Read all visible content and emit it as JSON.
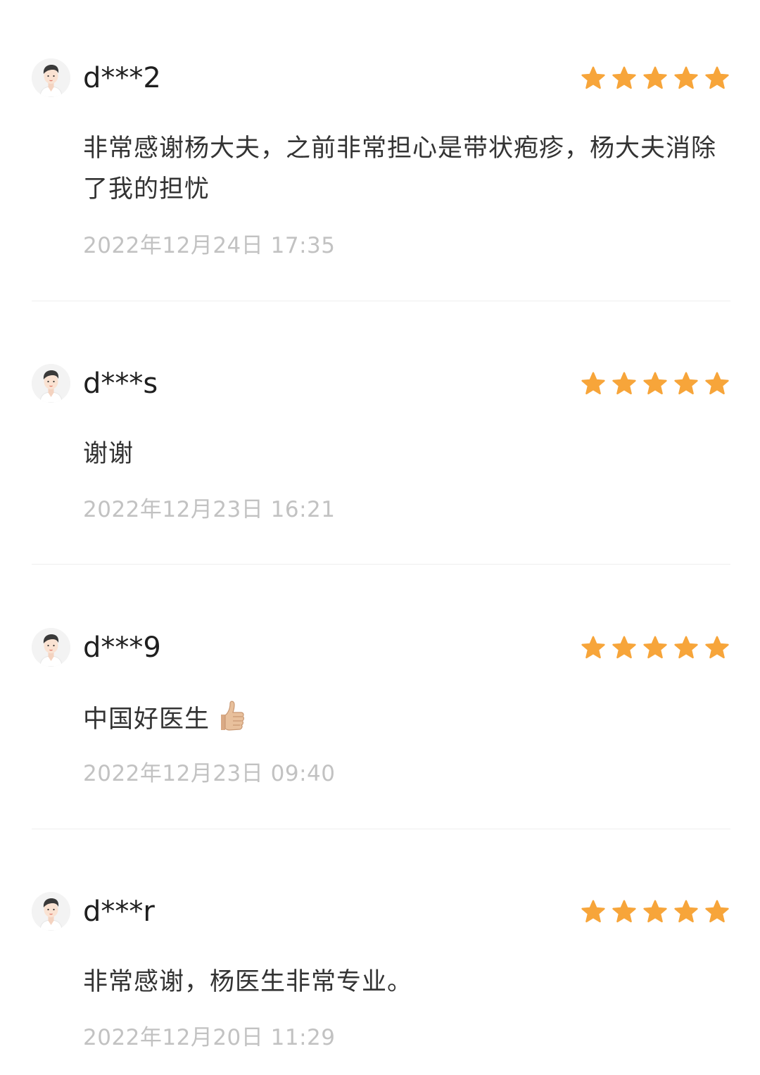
{
  "colors": {
    "star": "#f7a53a",
    "username": "#1f1f1f",
    "text": "#333333",
    "date": "#c2c2c2",
    "divider": "#eeeeee"
  },
  "reviews": [
    {
      "user": "d***2",
      "rating": 5,
      "text": "非常感谢杨大夫，之前非常担心是带状疱疹，杨大夫消除了我的担忧",
      "date": "2022年12月24日 17:35",
      "avatar_icon": "male-doctor-avatar-icon"
    },
    {
      "user": "d***s",
      "rating": 5,
      "text": "谢谢",
      "date": "2022年12月23日 16:21",
      "avatar_icon": "male-doctor-avatar-icon"
    },
    {
      "user": "d***9",
      "rating": 5,
      "text": "中国好医生",
      "text_emoji": "thumbs-up-emoji",
      "date": "2022年12月23日 09:40",
      "avatar_icon": "male-doctor-avatar-icon"
    },
    {
      "user": "d***r",
      "rating": 5,
      "text": "非常感谢，杨医生非常专业。",
      "date": "2022年12月20日 11:29",
      "avatar_icon": "male-doctor-avatar-icon"
    }
  ]
}
